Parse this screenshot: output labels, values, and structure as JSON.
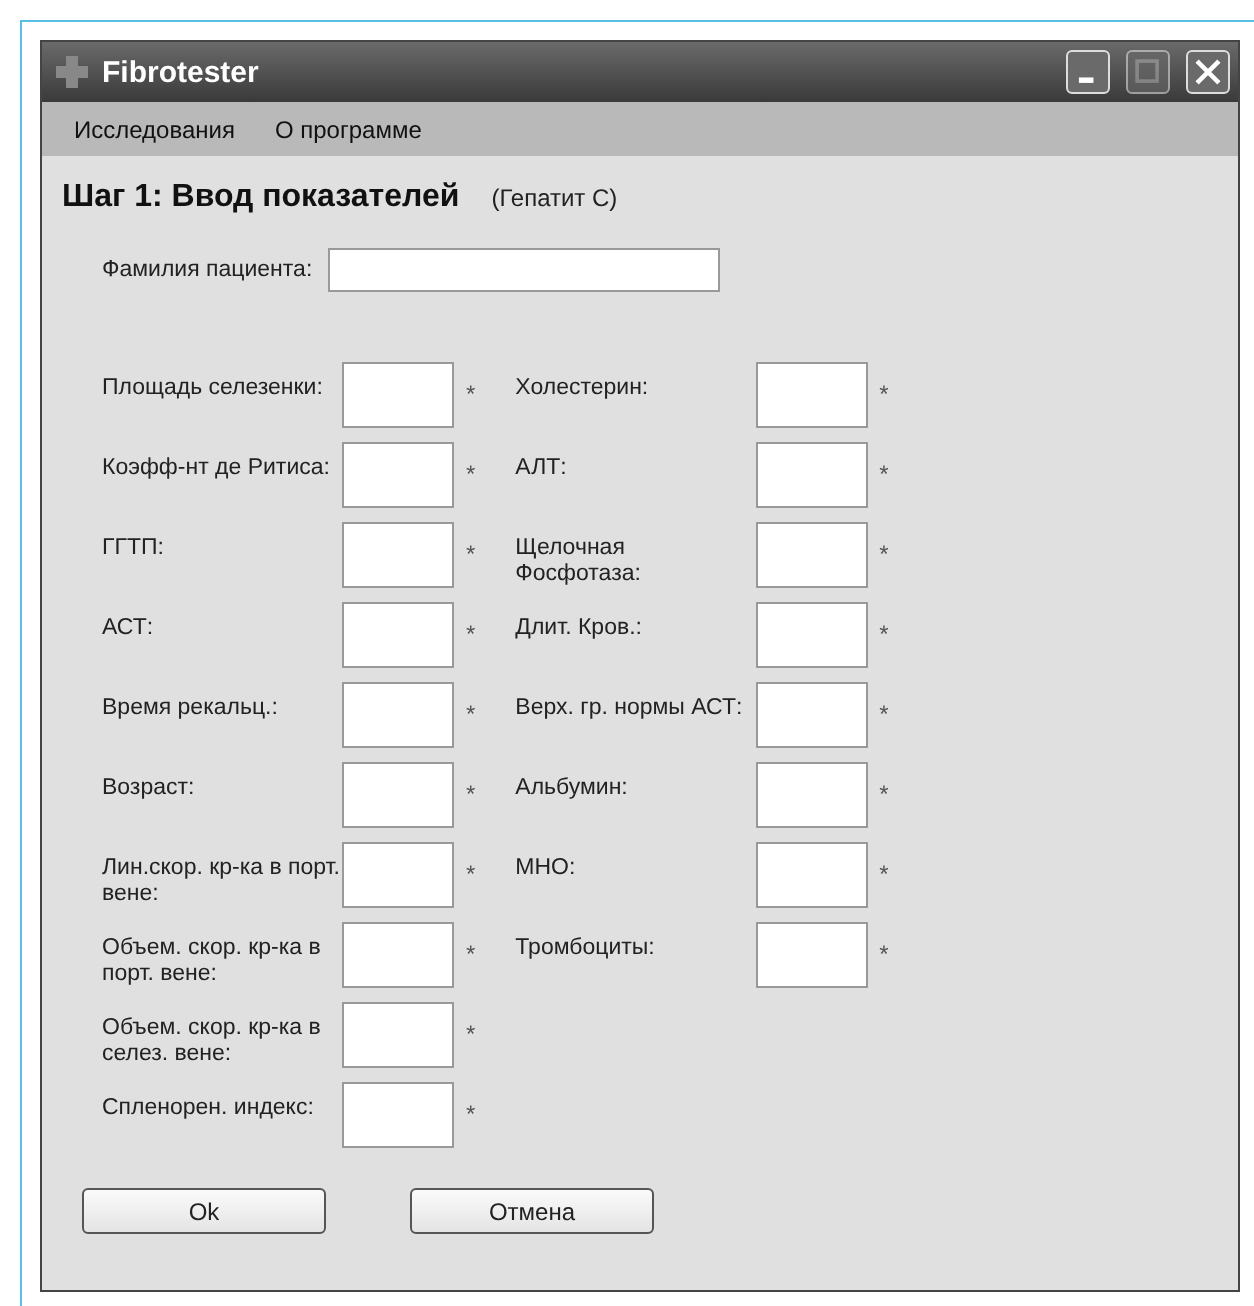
{
  "window": {
    "title": "Fibrotester"
  },
  "menu": [
    "Исследования",
    "О программе"
  ],
  "heading": {
    "title": "Шаг 1: Ввод показателей",
    "subtitle": "(Гепатит С)"
  },
  "patient": {
    "label": "Фамилия пациента:"
  },
  "left_fields": [
    {
      "label": "Площадь селезенки:",
      "mark": "*"
    },
    {
      "label": "Коэфф-нт де Ритиса:",
      "mark": "*"
    },
    {
      "label": "ГГТП:",
      "mark": "*"
    },
    {
      "label": "АСТ:",
      "mark": "*"
    },
    {
      "label": "Время рекальц.:",
      "mark": "*"
    },
    {
      "label": "Возраст:",
      "mark": "*"
    },
    {
      "label": "Лин.скор. кр-ка в порт. вене:",
      "mark": "*"
    },
    {
      "label": "Объем. скор. кр-ка в порт. вене:",
      "mark": "*"
    },
    {
      "label": "Объем. скор. кр-ка в селез. вене:",
      "mark": "*"
    },
    {
      "label": "Спленорен. индекс:",
      "mark": "*"
    }
  ],
  "right_fields": [
    {
      "label": "Холестерин:",
      "mark": "*"
    },
    {
      "label": "АЛТ:",
      "mark": "*"
    },
    {
      "label": "Щелочная Фосфотаза:",
      "mark": "*"
    },
    {
      "label": "Длит. Кров.:",
      "mark": "*"
    },
    {
      "label": "Верх. гр. нормы АСТ:",
      "mark": "*"
    },
    {
      "label": "Альбумин:",
      "mark": "*"
    },
    {
      "label": "МНО:",
      "mark": "*"
    },
    {
      "label": "Тромбоциты:",
      "mark": "*"
    }
  ],
  "buttons": [
    "Ok",
    "Отмена"
  ]
}
